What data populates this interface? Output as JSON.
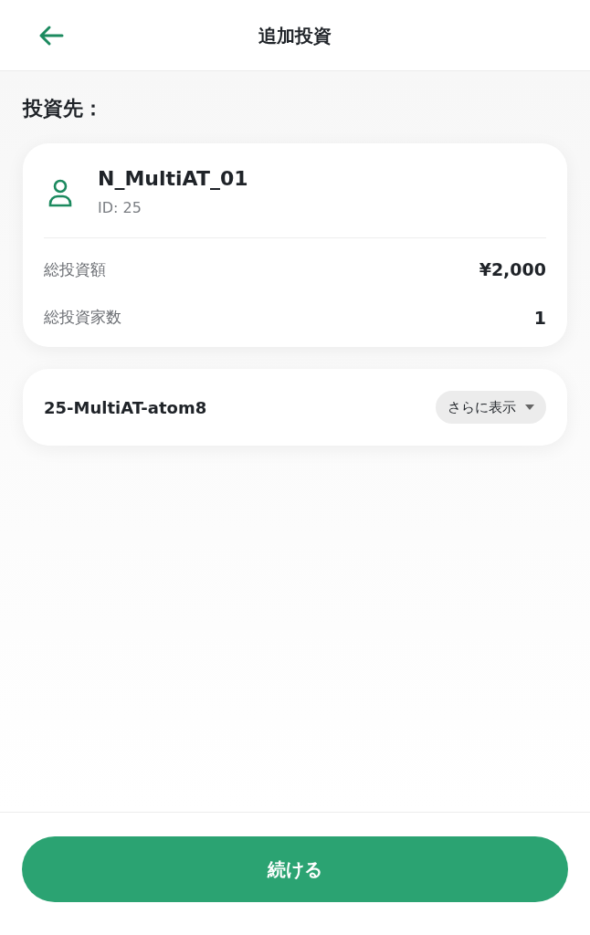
{
  "header": {
    "title": "追加投資"
  },
  "section_label": "投資先：",
  "investee": {
    "name": "N_MultiAT_01",
    "id": "ID: 25",
    "stats": [
      {
        "label": "総投資額",
        "value": "¥2,000"
      },
      {
        "label": "総投資家数",
        "value": "1"
      }
    ]
  },
  "item": {
    "name": "25-MultiAT-atom8",
    "more_button": "さらに表示"
  },
  "continue_button": "続ける"
}
